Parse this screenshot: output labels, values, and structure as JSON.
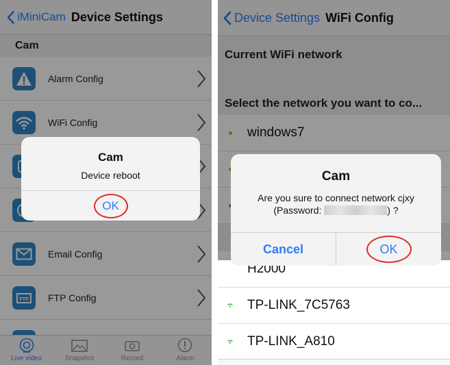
{
  "left": {
    "nav": {
      "back_label": "iMiniCam",
      "title": "Device Settings"
    },
    "section": "Cam",
    "rows": [
      {
        "label": "Alarm Config",
        "icon": "warning-icon"
      },
      {
        "label": "WiFi Config",
        "icon": "wifi-icon"
      },
      {
        "label": "",
        "icon": "settings-icon"
      },
      {
        "label": "",
        "icon": "clock-icon"
      },
      {
        "label": "Email Config",
        "icon": "email-icon"
      },
      {
        "label": "FTP Config",
        "icon": "ftp-icon"
      },
      {
        "label": "",
        "icon": "sd-card-icon"
      }
    ],
    "tabs": [
      {
        "label": "Live video",
        "icon": "live-video-icon",
        "active": true
      },
      {
        "label": "Snapshot",
        "icon": "snapshot-icon",
        "active": false
      },
      {
        "label": "Record",
        "icon": "record-icon",
        "active": false
      },
      {
        "label": "Alarm",
        "icon": "alarm-icon",
        "active": false
      }
    ],
    "alert": {
      "title": "Cam",
      "message": "Device reboot",
      "ok_label": "OK"
    }
  },
  "right": {
    "nav": {
      "back_label": "Device Settings",
      "title": "WiFi Config"
    },
    "current_header": "Current WiFi network",
    "select_header": "Select the network you want to co...",
    "networks": [
      {
        "name": "windows7",
        "dot_color": "#c8a61a"
      },
      {
        "name": "",
        "dot_color": "#c8a61a"
      },
      {
        "name": "",
        "dot_color": "#4caf50"
      },
      {
        "name": "H2000",
        "dot_color": "#4caf50"
      },
      {
        "name": "TP-LINK_7C5763",
        "dot_color": "#4caf50"
      },
      {
        "name": "TP-LINK_A810",
        "dot_color": "#4caf50"
      }
    ],
    "alert": {
      "title": "Cam",
      "message_line1": "Are you sure to connect network cjxy",
      "message_prefix": "(Password: ",
      "message_suffix": ") ?",
      "cancel_label": "Cancel",
      "ok_label": "OK"
    }
  },
  "colors": {
    "accent": "#2f7cf6",
    "highlight_circle": "#e02a2a",
    "icon_bg": "#2f86c6"
  }
}
